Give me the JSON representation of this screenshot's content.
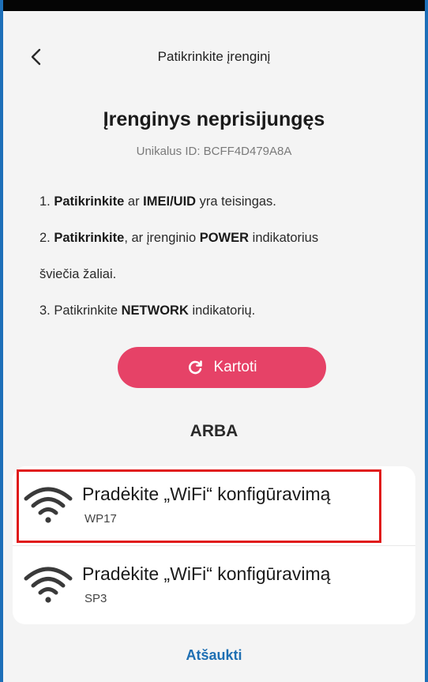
{
  "header": {
    "title": "Patikrinkite įrenginį",
    "back_icon": "chevron-left-icon"
  },
  "status": {
    "title": "Įrenginys neprisijungęs",
    "unique_id": "Unikalus ID: BCFF4D479A8A"
  },
  "steps": [
    {
      "prefix": "1. ",
      "bold1": "Patikrinkite",
      "mid1": " ar ",
      "bold2": "IMEI/UID",
      "suffix": " yra teisingas."
    },
    {
      "prefix": "2. ",
      "bold1": "Patikrinkite",
      "mid1": ", ar įrenginio ",
      "bold2": "POWER",
      "suffix": " indikatorius"
    },
    {
      "prefix": "",
      "bold1": "",
      "mid1": "šviečia žaliai.",
      "bold2": "",
      "suffix": ""
    },
    {
      "prefix": "3. Patikrinkite ",
      "bold1": "",
      "mid1": "",
      "bold2": "NETWORK",
      "suffix": " indikatorių."
    }
  ],
  "retry_button": {
    "label": "Kartoti",
    "icon": "refresh-icon",
    "color": "#e64267"
  },
  "or_label": "ARBA",
  "wifi_options": [
    {
      "title": "Pradėkite „WiFi“ konfigūravimą",
      "subtitle": "WP17",
      "icon": "wifi-icon"
    },
    {
      "title": "Pradėkite „WiFi“ konfigūravimą",
      "subtitle": "SP3",
      "icon": "wifi-icon"
    }
  ],
  "cancel_label": "Atšaukti",
  "colors": {
    "accent": "#e64267",
    "link": "#1e6fb3",
    "highlight": "#e01b1b"
  }
}
